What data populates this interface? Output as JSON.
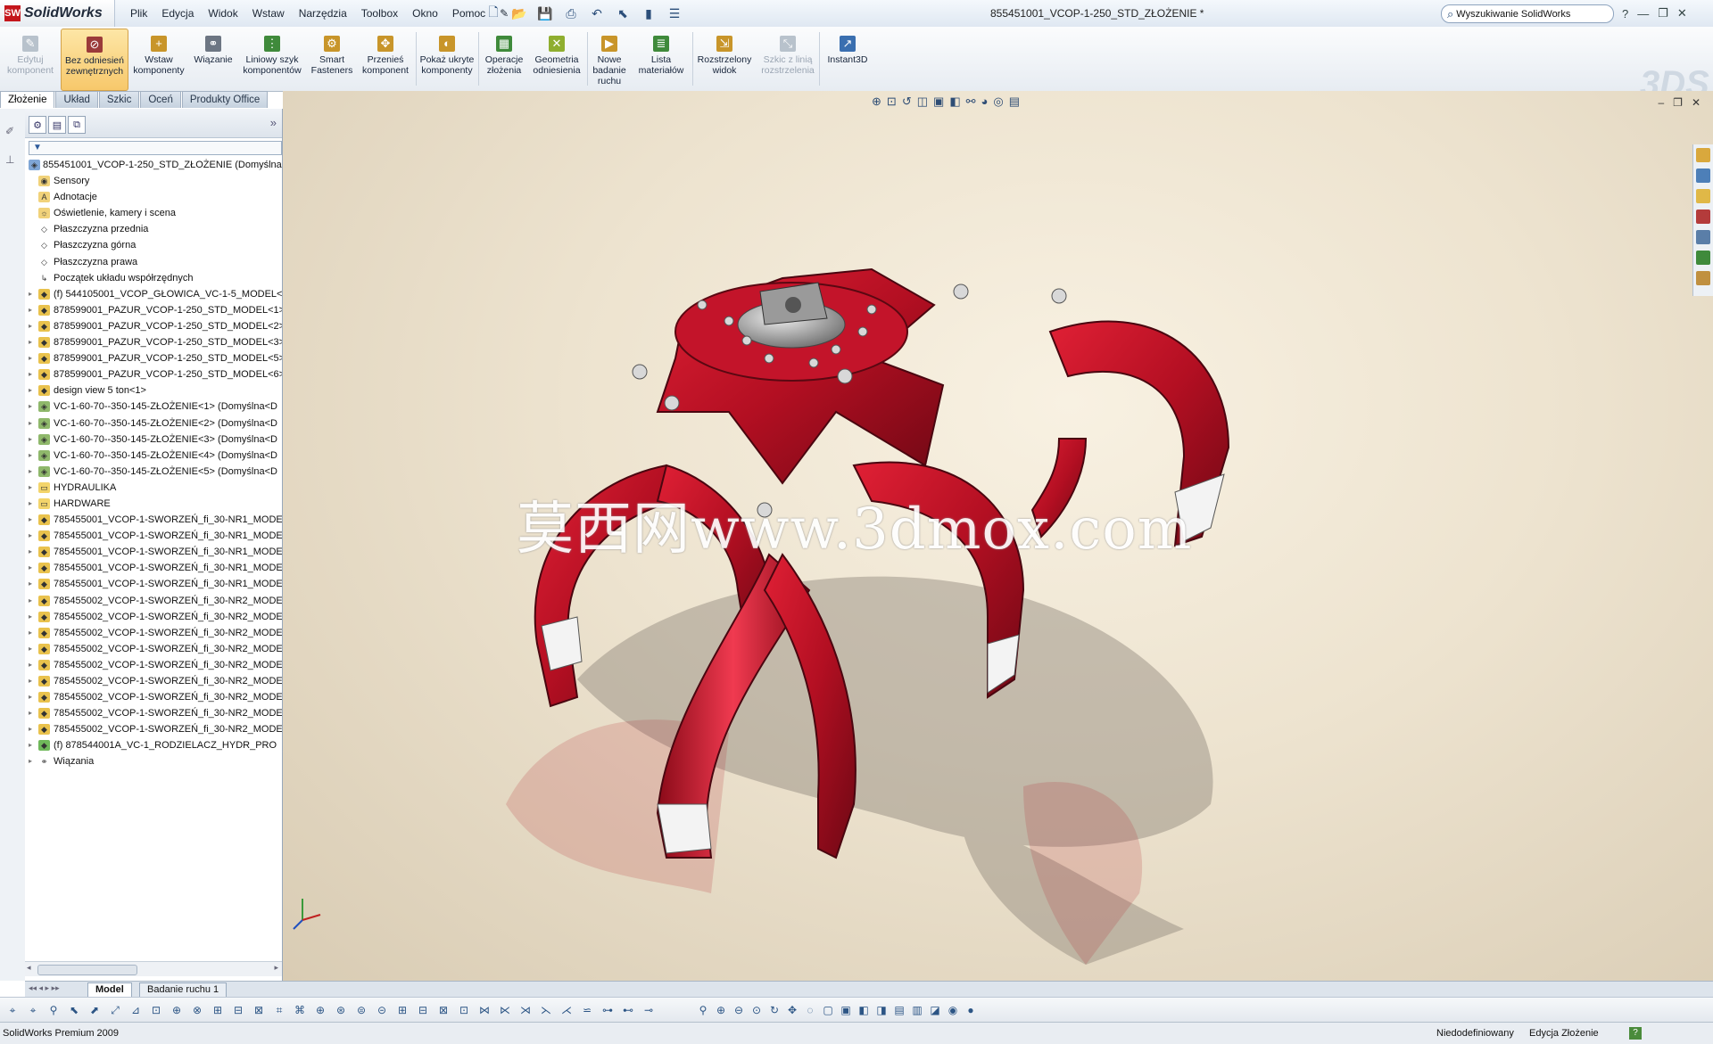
{
  "app": {
    "logo_text": "SolidWorks",
    "doc_title": "855451001_VCOP-1-250_STD_ZŁOŻENIE *"
  },
  "menu": [
    "Plik",
    "Edycja",
    "Widok",
    "Wstaw",
    "Narzędzia",
    "Toolbox",
    "Okno",
    "Pomoc"
  ],
  "search": {
    "placeholder": "Wyszukiwanie SolidWorks",
    "icon": "magnifier-icon"
  },
  "window_controls": [
    "?",
    "—",
    "❐",
    "✕"
  ],
  "ribbon": {
    "buttons": [
      {
        "label": "Edytuj komponent",
        "icon": "edit-component-icon",
        "state": "disabled"
      },
      {
        "label": "Bez odniesień zewnętrznych",
        "icon": "no-external-refs-icon",
        "state": "active"
      },
      {
        "label": "Wstaw komponenty",
        "icon": "insert-components-icon",
        "state": "normal"
      },
      {
        "label": "Wiązanie",
        "icon": "mate-icon",
        "state": "normal"
      },
      {
        "label": "Liniowy szyk komponentów",
        "icon": "linear-pattern-icon",
        "state": "normal"
      },
      {
        "label": "Smart Fasteners",
        "icon": "smart-fasteners-icon",
        "state": "normal"
      },
      {
        "label": "Przenieś komponent",
        "icon": "move-component-icon",
        "state": "normal"
      },
      {
        "label": "Pokaż ukryte komponenty",
        "icon": "show-hidden-icon",
        "state": "normal"
      },
      {
        "label": "Operacje złożenia",
        "icon": "assembly-features-icon",
        "state": "normal"
      },
      {
        "label": "Geometria odniesienia",
        "icon": "reference-geometry-icon",
        "state": "normal"
      },
      {
        "label": "Nowe badanie ruchu",
        "icon": "motion-study-icon",
        "state": "normal"
      },
      {
        "label": "Lista materiałów",
        "icon": "bill-of-materials-icon",
        "state": "normal"
      },
      {
        "label": "Rozstrzelony widok",
        "icon": "exploded-view-icon",
        "state": "normal"
      },
      {
        "label": "Szkic z linią rozstrzelenia",
        "icon": "explode-line-sketch-icon",
        "state": "disabled"
      },
      {
        "label": "Instant3D",
        "icon": "instant3d-icon",
        "state": "normal"
      }
    ]
  },
  "tabs": [
    {
      "label": "Złożenie",
      "selected": true
    },
    {
      "label": "Układ",
      "selected": false
    },
    {
      "label": "Szkic",
      "selected": false
    },
    {
      "label": "Oceń",
      "selected": false
    },
    {
      "label": "Produkty Office",
      "selected": false
    }
  ],
  "feature_tree": {
    "root": "855451001_VCOP-1-250_STD_ZŁOŻENIE  (Domyślna<",
    "items": [
      {
        "label": "Sensory",
        "icon": "sensor-folder-icon"
      },
      {
        "label": "Adnotacje",
        "icon": "annotations-icon"
      },
      {
        "label": "Oświetlenie, kamery i scena",
        "icon": "lights-cameras-icon"
      },
      {
        "label": "Płaszczyzna przednia",
        "icon": "plane-icon"
      },
      {
        "label": "Płaszczyzna górna",
        "icon": "plane-icon"
      },
      {
        "label": "Płaszczyzna prawa",
        "icon": "plane-icon"
      },
      {
        "label": "Początek układu współrzędnych",
        "icon": "origin-icon"
      },
      {
        "label": "(f) 544105001_VCOP_GŁOWICA_VC-1-5_MODEL<",
        "icon": "part-icon"
      },
      {
        "label": "878599001_PAZUR_VCOP-1-250_STD_MODEL<1>",
        "icon": "part-icon"
      },
      {
        "label": "878599001_PAZUR_VCOP-1-250_STD_MODEL<2>",
        "icon": "part-icon"
      },
      {
        "label": "878599001_PAZUR_VCOP-1-250_STD_MODEL<3>",
        "icon": "part-icon"
      },
      {
        "label": "878599001_PAZUR_VCOP-1-250_STD_MODEL<5>",
        "icon": "part-icon"
      },
      {
        "label": "878599001_PAZUR_VCOP-1-250_STD_MODEL<6>",
        "icon": "part-icon"
      },
      {
        "label": "design view 5 ton<1>",
        "icon": "part-icon"
      },
      {
        "label": "VC-1-60-70--350-145-ZŁOŻENIE<1> (Domyślna<D",
        "icon": "subassembly-icon"
      },
      {
        "label": "VC-1-60-70--350-145-ZŁOŻENIE<2> (Domyślna<D",
        "icon": "subassembly-icon"
      },
      {
        "label": "VC-1-60-70--350-145-ZŁOŻENIE<3> (Domyślna<D",
        "icon": "subassembly-icon"
      },
      {
        "label": "VC-1-60-70--350-145-ZŁOŻENIE<4> (Domyślna<D",
        "icon": "subassembly-icon"
      },
      {
        "label": "VC-1-60-70--350-145-ZŁOŻENIE<5> (Domyślna<D",
        "icon": "subassembly-icon"
      },
      {
        "label": "HYDRAULIKA",
        "icon": "folder-icon"
      },
      {
        "label": "HARDWARE",
        "icon": "folder-icon"
      },
      {
        "label": "785455001_VCOP-1-SWORZEŃ_fi_30-NR1_MODE",
        "icon": "part-icon"
      },
      {
        "label": "785455001_VCOP-1-SWORZEŃ_fi_30-NR1_MODE",
        "icon": "part-icon"
      },
      {
        "label": "785455001_VCOP-1-SWORZEŃ_fi_30-NR1_MODE",
        "icon": "part-icon"
      },
      {
        "label": "785455001_VCOP-1-SWORZEŃ_fi_30-NR1_MODE",
        "icon": "part-icon"
      },
      {
        "label": "785455001_VCOP-1-SWORZEŃ_fi_30-NR1_MODE",
        "icon": "part-icon"
      },
      {
        "label": "785455002_VCOP-1-SWORZEŃ_fi_30-NR2_MODE",
        "icon": "part-icon"
      },
      {
        "label": "785455002_VCOP-1-SWORZEŃ_fi_30-NR2_MODE",
        "icon": "part-icon"
      },
      {
        "label": "785455002_VCOP-1-SWORZEŃ_fi_30-NR2_MODE",
        "icon": "part-icon"
      },
      {
        "label": "785455002_VCOP-1-SWORZEŃ_fi_30-NR2_MODE",
        "icon": "part-icon"
      },
      {
        "label": "785455002_VCOP-1-SWORZEŃ_fi_30-NR2_MODE",
        "icon": "part-icon"
      },
      {
        "label": "785455002_VCOP-1-SWORZEŃ_fi_30-NR2_MODE",
        "icon": "part-icon"
      },
      {
        "label": "785455002_VCOP-1-SWORZEŃ_fi_30-NR2_MODE",
        "icon": "part-icon"
      },
      {
        "label": "785455002_VCOP-1-SWORZEŃ_fi_30-NR2_MODE",
        "icon": "part-icon"
      },
      {
        "label": "785455002_VCOP-1-SWORZEŃ_fi_30-NR2_MODE",
        "icon": "part-icon"
      },
      {
        "label": "(f) 878544001A_VC-1_RODZIELACZ_HYDR_PRO",
        "icon": "part-green-icon"
      },
      {
        "label": "Wiązania",
        "icon": "mates-icon"
      }
    ]
  },
  "viewport": {
    "watermark": "莫西网www.3dmox.com",
    "model_colors": {
      "body": "#c01226",
      "shadow": "#a0968a",
      "steel": "#b7b7b7"
    }
  },
  "bottom_tabs": [
    {
      "label": "Model",
      "selected": true
    },
    {
      "label": "Badanie ruchu 1",
      "selected": false
    }
  ],
  "status": {
    "left": "SolidWorks Premium 2009",
    "definition": "Niedodefiniowany",
    "mode": "Edycja Złożenie"
  }
}
